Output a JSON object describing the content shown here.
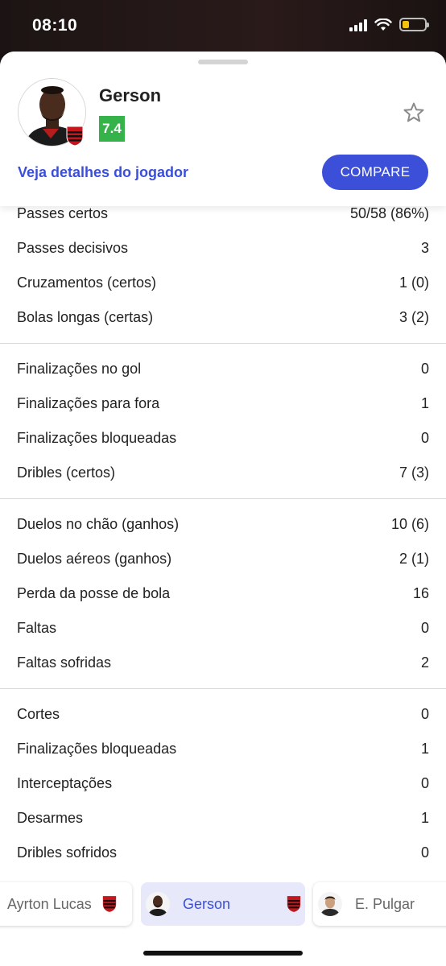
{
  "status_bar": {
    "time": "08:10",
    "battery_level": 0.3
  },
  "player": {
    "name": "Gerson",
    "rating": "7.4",
    "rating_color": "#36b24a",
    "details_link": "Veja detalhes do jogador",
    "compare_label": "COMPARE",
    "favorite_icon": "star-outline-icon"
  },
  "accent_color": "#3b4fd8",
  "stat_groups": [
    [
      {
        "label": "Passes certos",
        "value": "50/58 (86%)"
      },
      {
        "label": "Passes decisivos",
        "value": "3"
      },
      {
        "label": "Cruzamentos (certos)",
        "value": "1 (0)"
      },
      {
        "label": "Bolas longas (certas)",
        "value": "3 (2)"
      }
    ],
    [
      {
        "label": "Finalizações no gol",
        "value": "0"
      },
      {
        "label": "Finalizações para fora",
        "value": "1"
      },
      {
        "label": "Finalizações bloqueadas",
        "value": "0"
      },
      {
        "label": "Dribles (certos)",
        "value": "7 (3)"
      }
    ],
    [
      {
        "label": "Duelos no chão (ganhos)",
        "value": "10 (6)"
      },
      {
        "label": "Duelos aéreos (ganhos)",
        "value": "2 (1)"
      },
      {
        "label": "Perda da posse de bola",
        "value": "16"
      },
      {
        "label": "Faltas",
        "value": "0"
      },
      {
        "label": "Faltas sofridas",
        "value": "2"
      }
    ],
    [
      {
        "label": "Cortes",
        "value": "0"
      },
      {
        "label": "Finalizações bloqueadas",
        "value": "1"
      },
      {
        "label": "Interceptações",
        "value": "0"
      },
      {
        "label": "Desarmes",
        "value": "1"
      },
      {
        "label": "Dribles sofridos",
        "value": "0"
      }
    ]
  ],
  "carousel": {
    "players": [
      {
        "name": "Ayrton Lucas",
        "active": false
      },
      {
        "name": "Gerson",
        "active": true
      },
      {
        "name": "E. Pulgar",
        "active": false
      }
    ]
  }
}
